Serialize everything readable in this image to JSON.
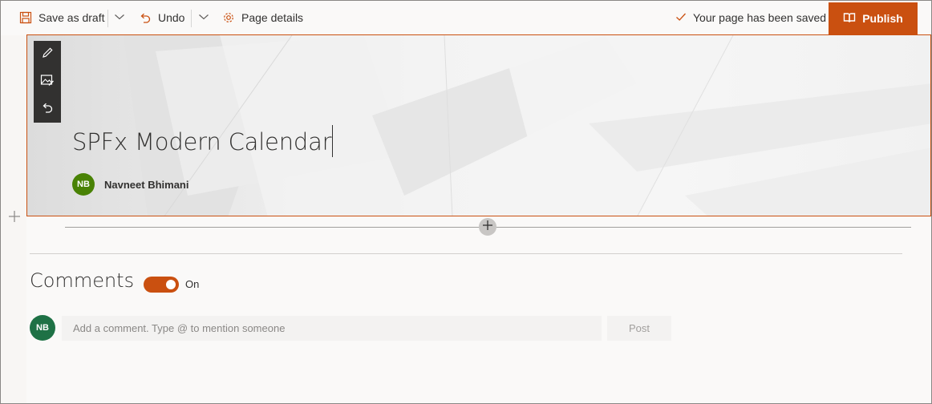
{
  "toolbar": {
    "save_draft_label": "Save as draft",
    "undo_label": "Undo",
    "page_details_label": "Page details",
    "saved_status": "Your page has been saved",
    "publish_label": "Publish"
  },
  "header": {
    "title": "SPFx Modern Calendar",
    "author": {
      "initials": "NB",
      "name": "Navneet Bhimani"
    }
  },
  "comments": {
    "title": "Comments",
    "toggle_state": "On",
    "user_initials": "NB",
    "input_placeholder": "Add a comment. Type @ to mention someone",
    "post_label": "Post"
  },
  "colors": {
    "accent": "#ca5010",
    "author_avatar": "#498205",
    "commenter_avatar": "#1e7145"
  },
  "icons": {
    "save": "save-icon",
    "undo": "undo-icon",
    "page_details": "gear-icon",
    "saved": "checkmark-icon",
    "publish": "book-icon",
    "edit": "pencil-icon",
    "change_image": "image-edit-icon",
    "reset": "undo-icon",
    "add": "plus-icon"
  }
}
